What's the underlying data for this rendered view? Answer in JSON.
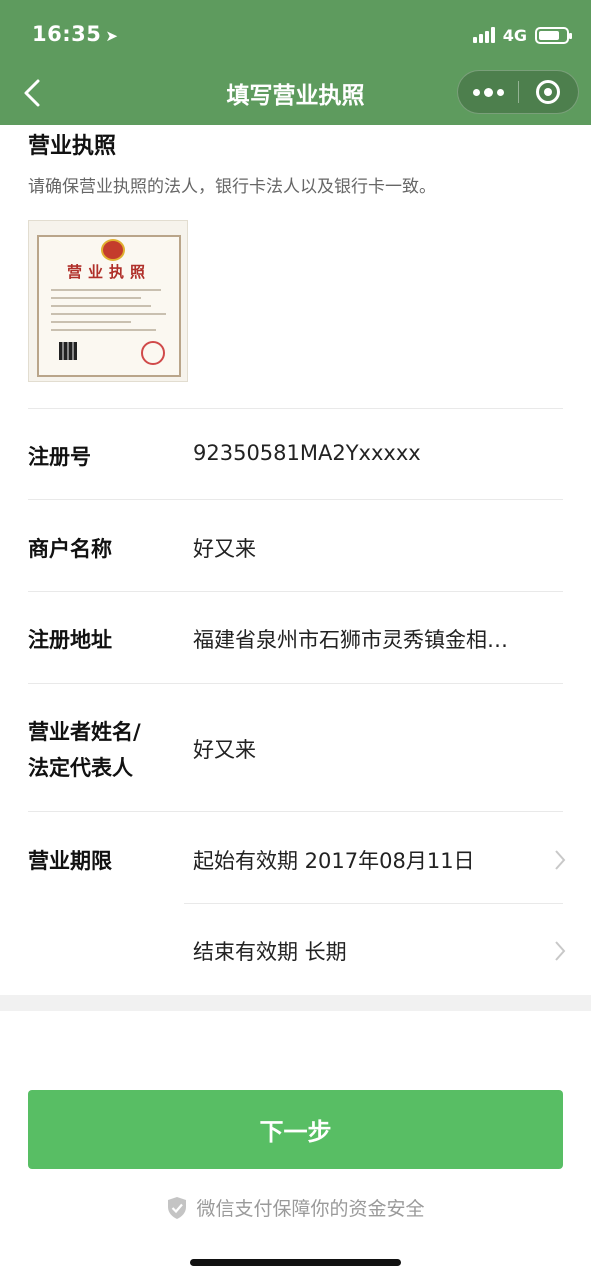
{
  "status_bar": {
    "time": "16:35",
    "network": "4G"
  },
  "nav": {
    "title": "填写营业执照",
    "icons": {
      "back": "chevron-left-icon",
      "more": "more-dots-icon",
      "close": "target-close-icon"
    }
  },
  "license_section": {
    "title": "营业执照",
    "description": "请确保营业执照的法人，银行卡法人以及银行卡一致。",
    "image_title": "营业执照"
  },
  "fields": [
    {
      "label": "注册号",
      "value": "92350581MA2Yxxxxx"
    },
    {
      "label": "商户名称",
      "value": "好又来"
    },
    {
      "label": "注册地址",
      "value": "福建省泉州市石狮市灵秀镇金相…"
    },
    {
      "label_line1": "营业者姓名/",
      "label_line2": "法定代表人",
      "value": "好又来"
    },
    {
      "label": "营业期限",
      "value": "起始有效期 2017年08月11日"
    },
    {
      "label": "",
      "value": "结束有效期 长期"
    }
  ],
  "actions": {
    "next_label": "下一步"
  },
  "footer": {
    "text": "微信支付保障你的资金安全"
  },
  "colors": {
    "header": "#5e9b5e",
    "primary_button": "#58be64"
  }
}
